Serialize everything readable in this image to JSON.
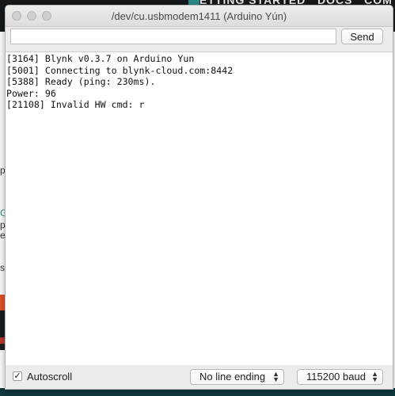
{
  "background": {
    "nav_text": "ETTING STARTED   DOCS   COM",
    "side_letters": [
      "p",
      "G",
      "p",
      "e",
      "s"
    ]
  },
  "window": {
    "title": "/dev/cu.usbmodem1411 (Arduino Yún)",
    "send_input": {
      "value": "",
      "placeholder": ""
    },
    "send_label": "Send",
    "output_lines": [
      "[3164] Blynk v0.3.7 on Arduino Yun",
      "[5001] Connecting to blynk-cloud.com:8442",
      "[5388] Ready (ping: 230ms).",
      "Power: 96",
      "[21108] Invalid HW cmd: r"
    ],
    "autoscroll_checkmark": "✓",
    "autoscroll_label": "Autoscroll",
    "autoscroll_checked": true,
    "line_ending": "No line ending",
    "baud_rate": "115200 baud",
    "dropdown_icon": "up-down-chevron-icon"
  },
  "colors": {
    "header_bg": "#16191b",
    "accent_orange": "#e6542a",
    "accent_teal": "#2b8c87"
  }
}
